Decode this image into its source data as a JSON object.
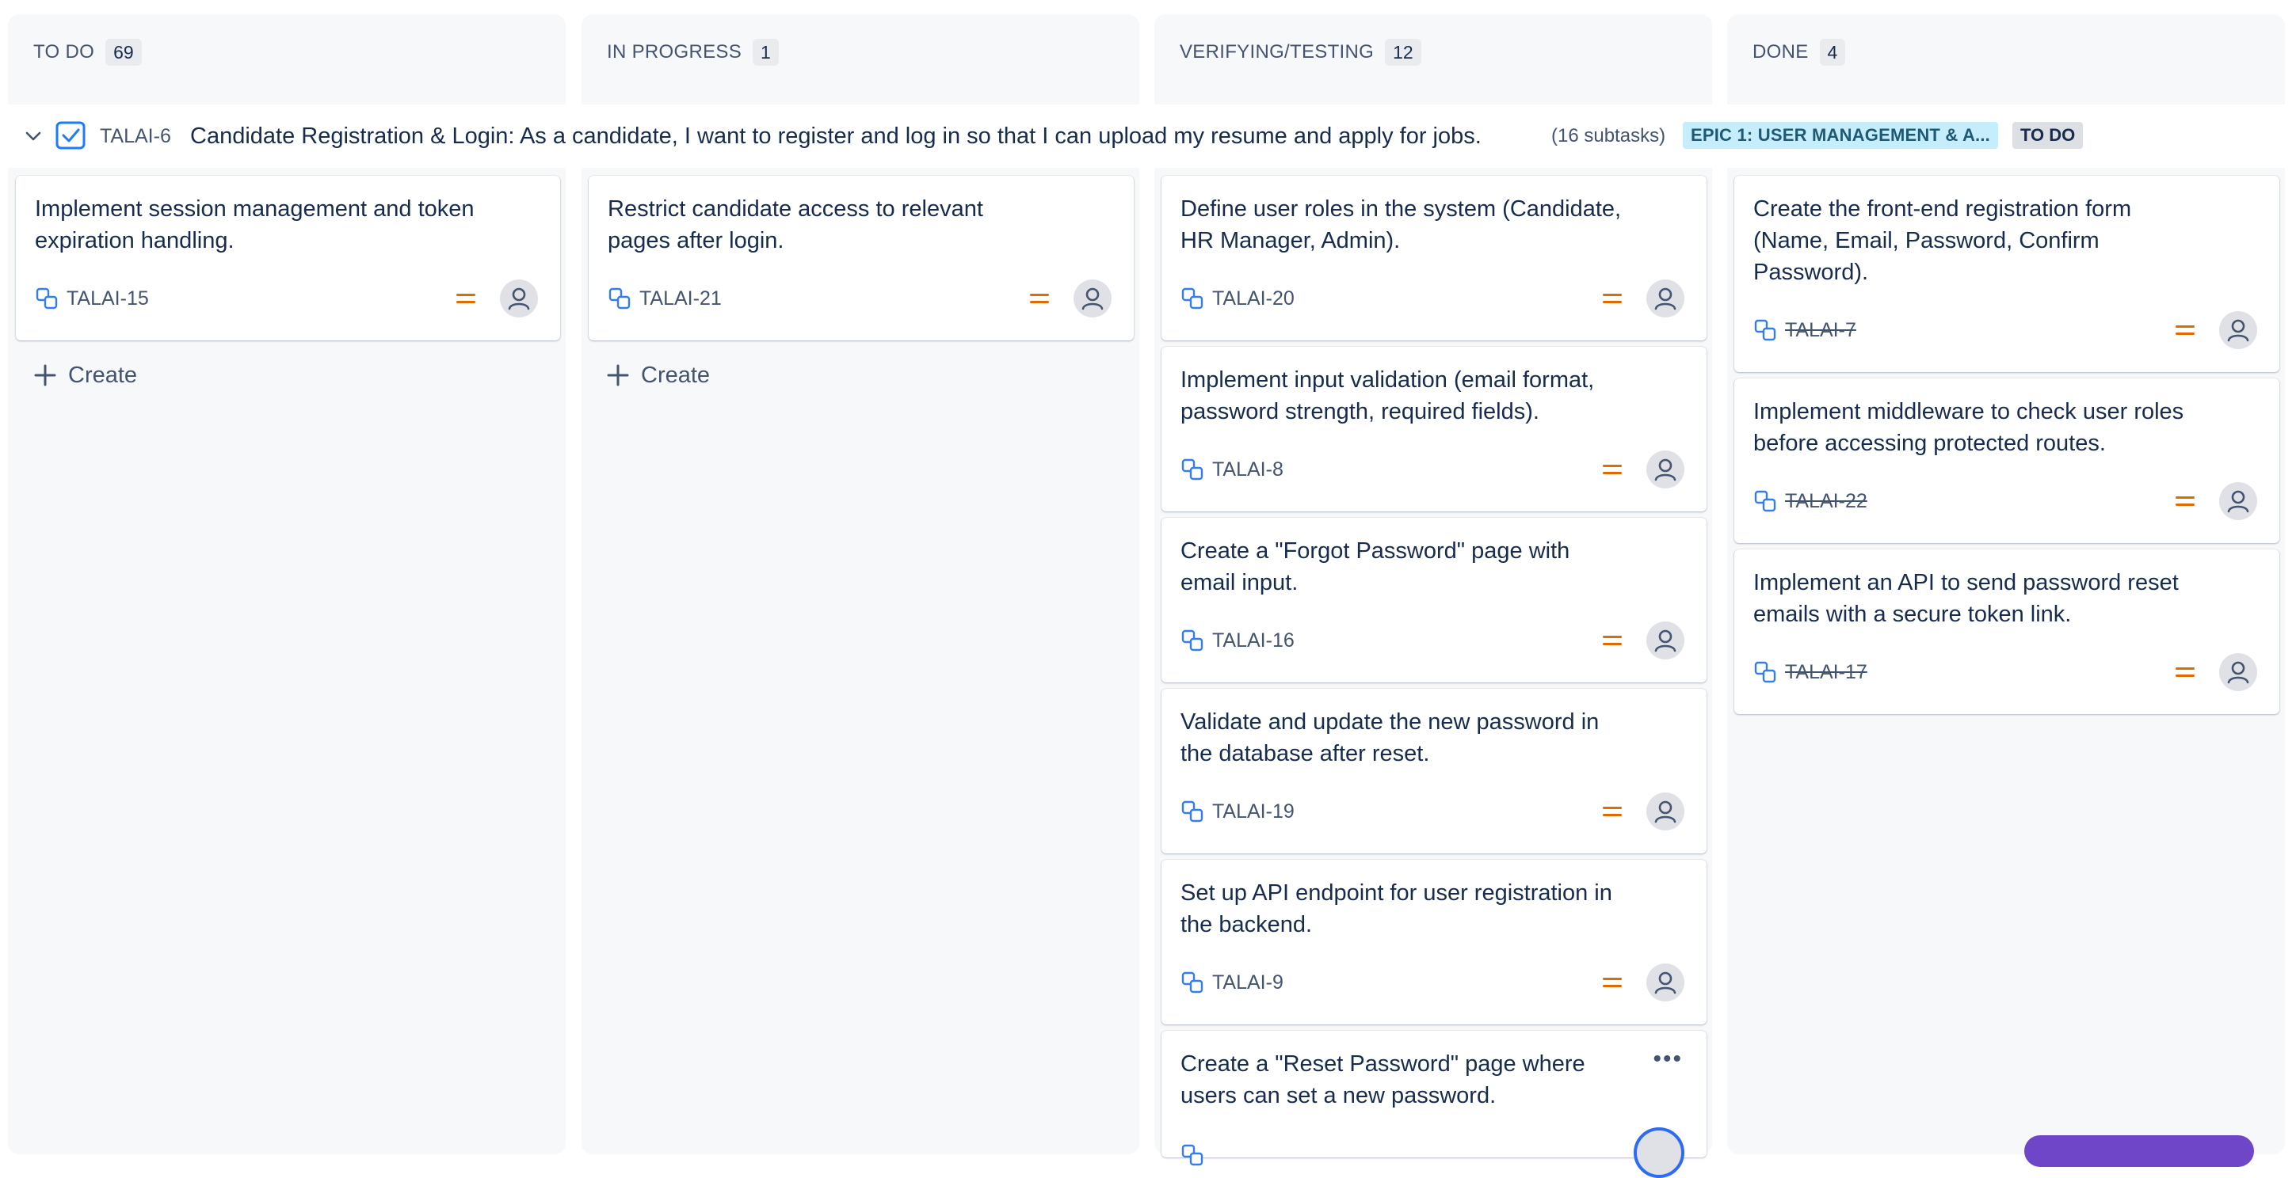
{
  "columns": [
    {
      "title": "TO DO",
      "count": "69"
    },
    {
      "title": "IN PROGRESS",
      "count": "1"
    },
    {
      "title": "VERIFYING/TESTING",
      "count": "12"
    },
    {
      "title": "DONE",
      "count": "4"
    }
  ],
  "swimlane": {
    "key": "TALAI-6",
    "summary": "Candidate Registration & Login: As a candidate, I want to register and log in so that I can upload my resume and apply for jobs.",
    "subtasks": "(16 subtasks)",
    "epic": "EPIC 1: USER MANAGEMENT & A...",
    "status": "TO DO"
  },
  "create_label": "Create",
  "cards": {
    "todo": [
      {
        "summary": "Implement session management and token expiration handling.",
        "key": "TALAI-15"
      }
    ],
    "in_progress": [
      {
        "summary": "Restrict candidate access to relevant pages after login.",
        "key": "TALAI-21"
      }
    ],
    "verifying": [
      {
        "summary": "Define user roles in the system (Candidate, HR Manager, Admin).",
        "key": "TALAI-20"
      },
      {
        "summary": "Implement input validation (email format, password strength, required fields).",
        "key": "TALAI-8"
      },
      {
        "summary": "Create a \"Forgot Password\" page with email input.",
        "key": "TALAI-16"
      },
      {
        "summary": "Validate and update the new password in the database after reset.",
        "key": "TALAI-19"
      },
      {
        "summary": "Set up API endpoint for user registration in the backend.",
        "key": "TALAI-9"
      },
      {
        "summary": "Create a \"Reset Password\" page where users can set a new password.",
        "key": ""
      }
    ],
    "done": [
      {
        "summary": "Create the front-end registration form (Name, Email, Password, Confirm Password).",
        "key": "TALAI-7"
      },
      {
        "summary": "Implement middleware to check user roles before accessing protected routes.",
        "key": "TALAI-22"
      },
      {
        "summary": "Implement an API to send password reset emails with a secure token link.",
        "key": "TALAI-17"
      }
    ]
  },
  "icons": {
    "subtask": "subtask-icon",
    "priority": "priority-medium-icon",
    "assignee": "user-avatar-icon",
    "epic": "checkbox-story-icon",
    "collapse": "chevron-down-icon",
    "more": "more-actions-icon"
  },
  "colors": {
    "column_bg": "#f7f8f9",
    "subtask_icon": "#357de8",
    "priority_medium": "#e06c00",
    "epic_lozenge_bg": "#c6edfb",
    "status_lozenge_bg": "#dcdfe4",
    "fab": "#6e46c7"
  }
}
